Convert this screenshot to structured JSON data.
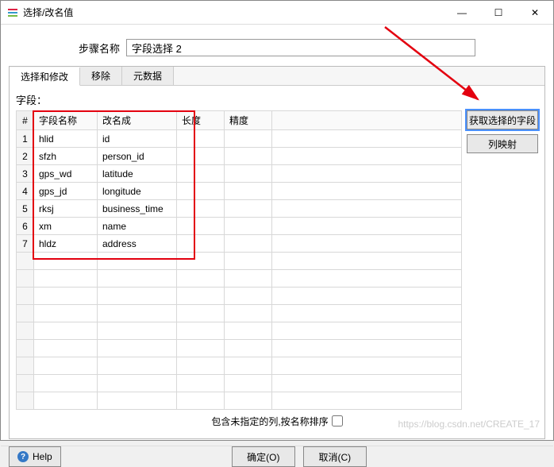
{
  "window": {
    "title": "选择/改名值",
    "minimize": "—",
    "maximize": "☐",
    "close": "✕"
  },
  "step": {
    "label": "步骤名称",
    "value": "字段选择 2"
  },
  "tabs": [
    {
      "label": "选择和修改",
      "active": true
    },
    {
      "label": "移除",
      "active": false
    },
    {
      "label": "元数据",
      "active": false
    }
  ],
  "fieldsLabel": "字段：",
  "columns": {
    "num": "#",
    "name": "字段名称",
    "rename": "改名成",
    "length": "长度",
    "precision": "精度"
  },
  "rows": [
    {
      "n": "1",
      "name": "hlid",
      "rename": "id",
      "length": "",
      "precision": ""
    },
    {
      "n": "2",
      "name": "sfzh",
      "rename": "person_id",
      "length": "",
      "precision": ""
    },
    {
      "n": "3",
      "name": "gps_wd",
      "rename": "latitude",
      "length": "",
      "precision": ""
    },
    {
      "n": "4",
      "name": "gps_jd",
      "rename": "longitude",
      "length": "",
      "precision": ""
    },
    {
      "n": "5",
      "name": "rksj",
      "rename": "business_time",
      "length": "",
      "precision": ""
    },
    {
      "n": "6",
      "name": "xm",
      "rename": "name",
      "length": "",
      "precision": ""
    },
    {
      "n": "7",
      "name": "hldz",
      "rename": "address",
      "length": "",
      "precision": ""
    }
  ],
  "emptyRows": 9,
  "sideButtons": {
    "getFields": "获取选择的字段",
    "mapping": "列映射"
  },
  "includeUnspecified": {
    "label": "包含未指定的列,按名称排序",
    "checked": false
  },
  "buttons": {
    "help": "Help",
    "ok": "确定(O)",
    "cancel": "取消(C)"
  },
  "watermark": "https://blog.csdn.net/CREATE_17"
}
